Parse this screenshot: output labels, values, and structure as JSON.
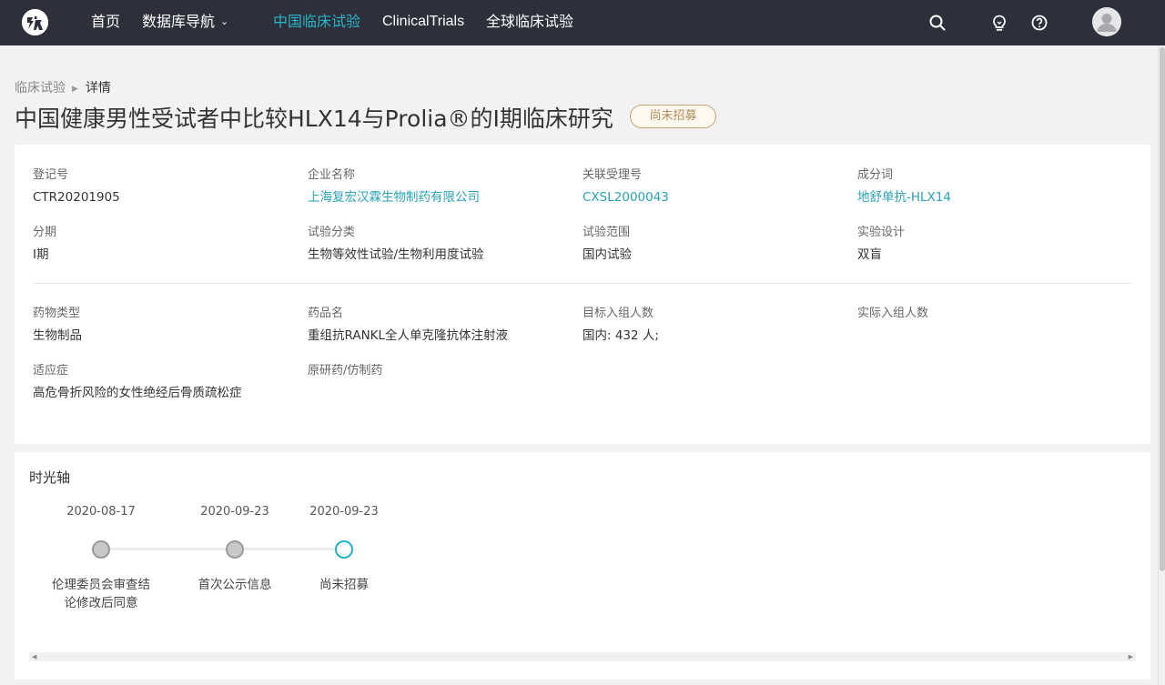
{
  "nav": {
    "home": "首页",
    "database_nav": "数据库导航",
    "china_trials": "中国临床试验",
    "clinicaltrials": "ClinicalTrials",
    "global_trials": "全球临床试验",
    "active_color": "#29b6c6"
  },
  "breadcrumb": {
    "parent": "临床试验",
    "current": "详情"
  },
  "page": {
    "title": "中国健康男性受试者中比较HLX14与Prolia®的I期临床研究",
    "status": "尚未招募"
  },
  "info": {
    "registration_no": {
      "label": "登记号",
      "value": "CTR20201905"
    },
    "company": {
      "label": "企业名称",
      "value": "上海复宏汉霖生物制药有限公司"
    },
    "acceptance_no": {
      "label": "关联受理号",
      "value": "CXSL2000043"
    },
    "ingredient": {
      "label": "成分词",
      "value": "地舒单抗-HLX14"
    },
    "phase": {
      "label": "分期",
      "value": "I期"
    },
    "trial_category": {
      "label": "试验分类",
      "value": "生物等效性试验/生物利用度试验"
    },
    "trial_scope": {
      "label": "试验范围",
      "value": "国内试验"
    },
    "design": {
      "label": "实验设计",
      "value": "双盲"
    },
    "drug_type": {
      "label": "药物类型",
      "value": "生物制品"
    },
    "drug_name": {
      "label": "药品名",
      "value": "重组抗RANKL全人单克隆抗体注射液"
    },
    "target_enrollment": {
      "label": "目标入组人数",
      "value": "国内: 432 人;"
    },
    "actual_enrollment": {
      "label": "实际入组人数",
      "value": ""
    },
    "indication": {
      "label": "适应症",
      "value": "高危骨折风险的女性绝经后骨质疏松症"
    },
    "originator_generic": {
      "label": "原研药/仿制药",
      "value": ""
    }
  },
  "timeline": {
    "title": "时光轴",
    "events": [
      {
        "date": "2020-08-17",
        "label": "伦理委员会审查结论修改后同意",
        "state": "done"
      },
      {
        "date": "2020-09-23",
        "label": "首次公示信息",
        "state": "done"
      },
      {
        "date": "2020-09-23",
        "label": "尚未招募",
        "state": "current"
      }
    ]
  }
}
